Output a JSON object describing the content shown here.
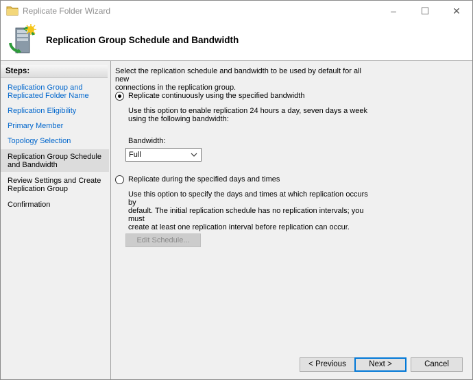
{
  "window": {
    "title": "Replicate Folder Wizard",
    "minimize": "–",
    "maximize": "☐",
    "close": "✕"
  },
  "header": {
    "title": "Replication Group Schedule and Bandwidth",
    "icon": "server-replication-icon"
  },
  "steps": {
    "header": "Steps:",
    "items": [
      {
        "line1": "Replication Group and",
        "line2": "Replicated Folder Name",
        "state": "link"
      },
      {
        "line1": "Replication Eligibility",
        "line2": "",
        "state": "link"
      },
      {
        "line1": "Primary Member",
        "line2": "",
        "state": "link"
      },
      {
        "line1": "Topology Selection",
        "line2": "",
        "state": "link"
      },
      {
        "line1": "Replication Group Schedule",
        "line2": "and Bandwidth",
        "state": "current"
      },
      {
        "line1": "Review Settings and Create",
        "line2": "Replication Group",
        "state": "pending"
      },
      {
        "line1": "Confirmation",
        "line2": "",
        "state": "pending"
      }
    ]
  },
  "main": {
    "intro_line1": "Select the replication schedule and bandwidth to be used by default for all new",
    "intro_line2": "connections in the replication group.",
    "option_continuous": {
      "label": "Replicate continuously using the specified bandwidth",
      "selected": true,
      "desc_line1": "Use this option to enable replication 24 hours a day, seven days a week",
      "desc_line2": "using the following bandwidth:"
    },
    "bandwidth": {
      "label": "Bandwidth:",
      "value": "Full"
    },
    "option_schedule": {
      "label": "Replicate during the specified days and times",
      "selected": false,
      "desc_line1": "Use this option to specify the days and times at which replication occurs by",
      "desc_line2": "default. The initial replication schedule has no replication intervals; you must",
      "desc_line3": "create at least one replication interval before replication can occur."
    },
    "edit_schedule_label": "Edit Schedule..."
  },
  "footer": {
    "previous": "< Previous",
    "next": "Next >",
    "cancel": "Cancel"
  },
  "colors": {
    "link": "#0066cc",
    "panel": "#f0f0f0",
    "default_button_border": "#0078d7"
  }
}
